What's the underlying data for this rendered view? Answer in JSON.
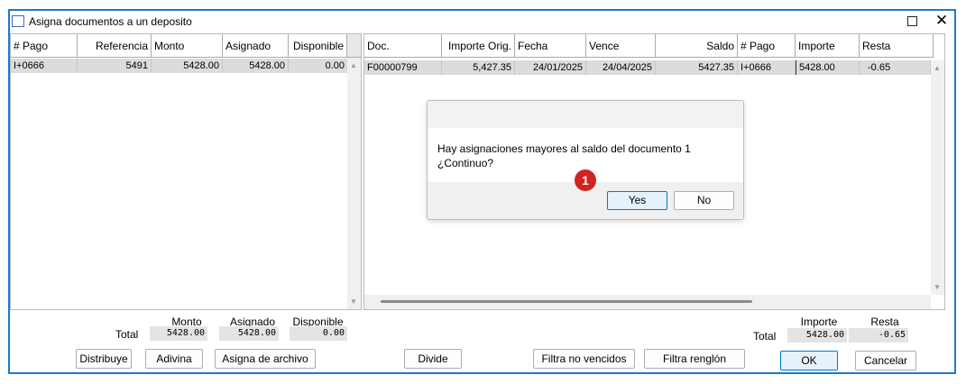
{
  "window": {
    "title": "Asigna documentos a un deposito",
    "maximize_icon": "maximize-icon",
    "close_icon": "close-icon"
  },
  "left_grid": {
    "columns": [
      "# Pago",
      "Referencia",
      "Monto",
      "Asignado",
      "Disponible"
    ],
    "rows": [
      [
        "I+0666",
        "5491",
        "5428.00",
        "5428.00",
        "0.00"
      ]
    ]
  },
  "right_grid": {
    "columns": [
      "Doc.",
      "Importe  Orig.",
      "Fecha",
      "Vence",
      "Saldo",
      "# Pago",
      "Importe",
      "Resta"
    ],
    "rows": [
      [
        "F00000799",
        "5,427.35",
        "24/01/2025",
        "24/04/2025",
        "5427.35",
        "I+0666",
        "5428.00",
        "-0.65"
      ]
    ]
  },
  "left_totals": {
    "total_label": "Total",
    "labels": [
      "Monto",
      "Asignado",
      "Disponible"
    ],
    "values": [
      "5428.00",
      "5428.00",
      "0.00"
    ]
  },
  "right_totals": {
    "total_label": "Total",
    "labels": [
      "Importe",
      "Resta"
    ],
    "values": [
      "5428.00",
      "-0.65"
    ]
  },
  "buttons": {
    "distribuye": "Distribuye",
    "adivina": "Adivina",
    "asigna_archivo": "Asigna de archivo",
    "divide": "Divide",
    "filtra_no_vencidos": "Filtra no vencidos",
    "filtra_renglon": "Filtra renglón",
    "ok": "OK",
    "cancelar": "Cancelar"
  },
  "dialog": {
    "line1": "Hay asignaciones mayores al saldo del documento  1",
    "line2": "¿Continuo?",
    "yes": "Yes",
    "no": "No"
  },
  "annotation": {
    "badge": "1",
    "color": "#d32222"
  },
  "colors": {
    "window_border": "#1e7ac8",
    "selected_row": "#dcdcdc",
    "primary_button_border": "#0078d4"
  }
}
